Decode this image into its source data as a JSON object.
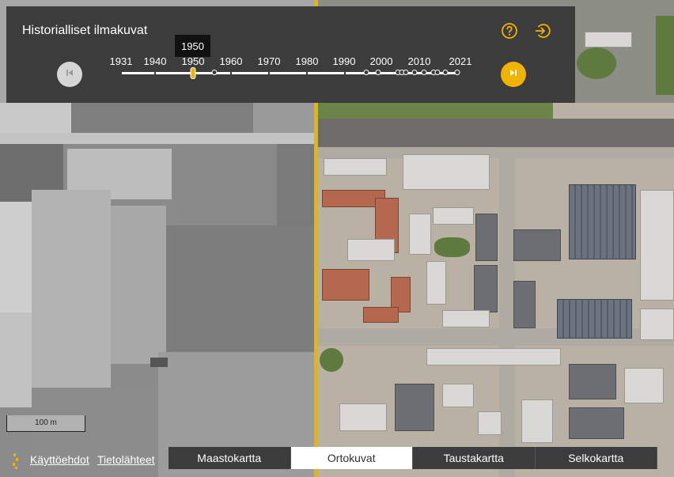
{
  "panel": {
    "title": "Historialliset ilmakuvat",
    "help_icon": "question-circle-icon",
    "exit_icon": "sign-in-icon",
    "prev_icon": "skip-back-icon",
    "next_icon": "skip-forward-icon"
  },
  "timeline": {
    "selected_year": "1950",
    "year_labels": [
      "1931",
      "1940",
      "1950",
      "1960",
      "1970",
      "1980",
      "1990",
      "2000",
      "2010",
      "2021"
    ]
  },
  "scale": {
    "label": "100 m"
  },
  "footer": {
    "terms_link": "Käyttöehdot",
    "sources_link": "Tietolähteet",
    "tabs": [
      {
        "label": "Maastokartta",
        "active": false
      },
      {
        "label": "Ortokuvat",
        "active": true
      },
      {
        "label": "Taustakartta",
        "active": false
      },
      {
        "label": "Selkokartta",
        "active": false
      }
    ]
  },
  "colors": {
    "accent": "#f0b400",
    "panel_bg": "#3c3c3c",
    "active_tab_bg": "#ffffff"
  }
}
